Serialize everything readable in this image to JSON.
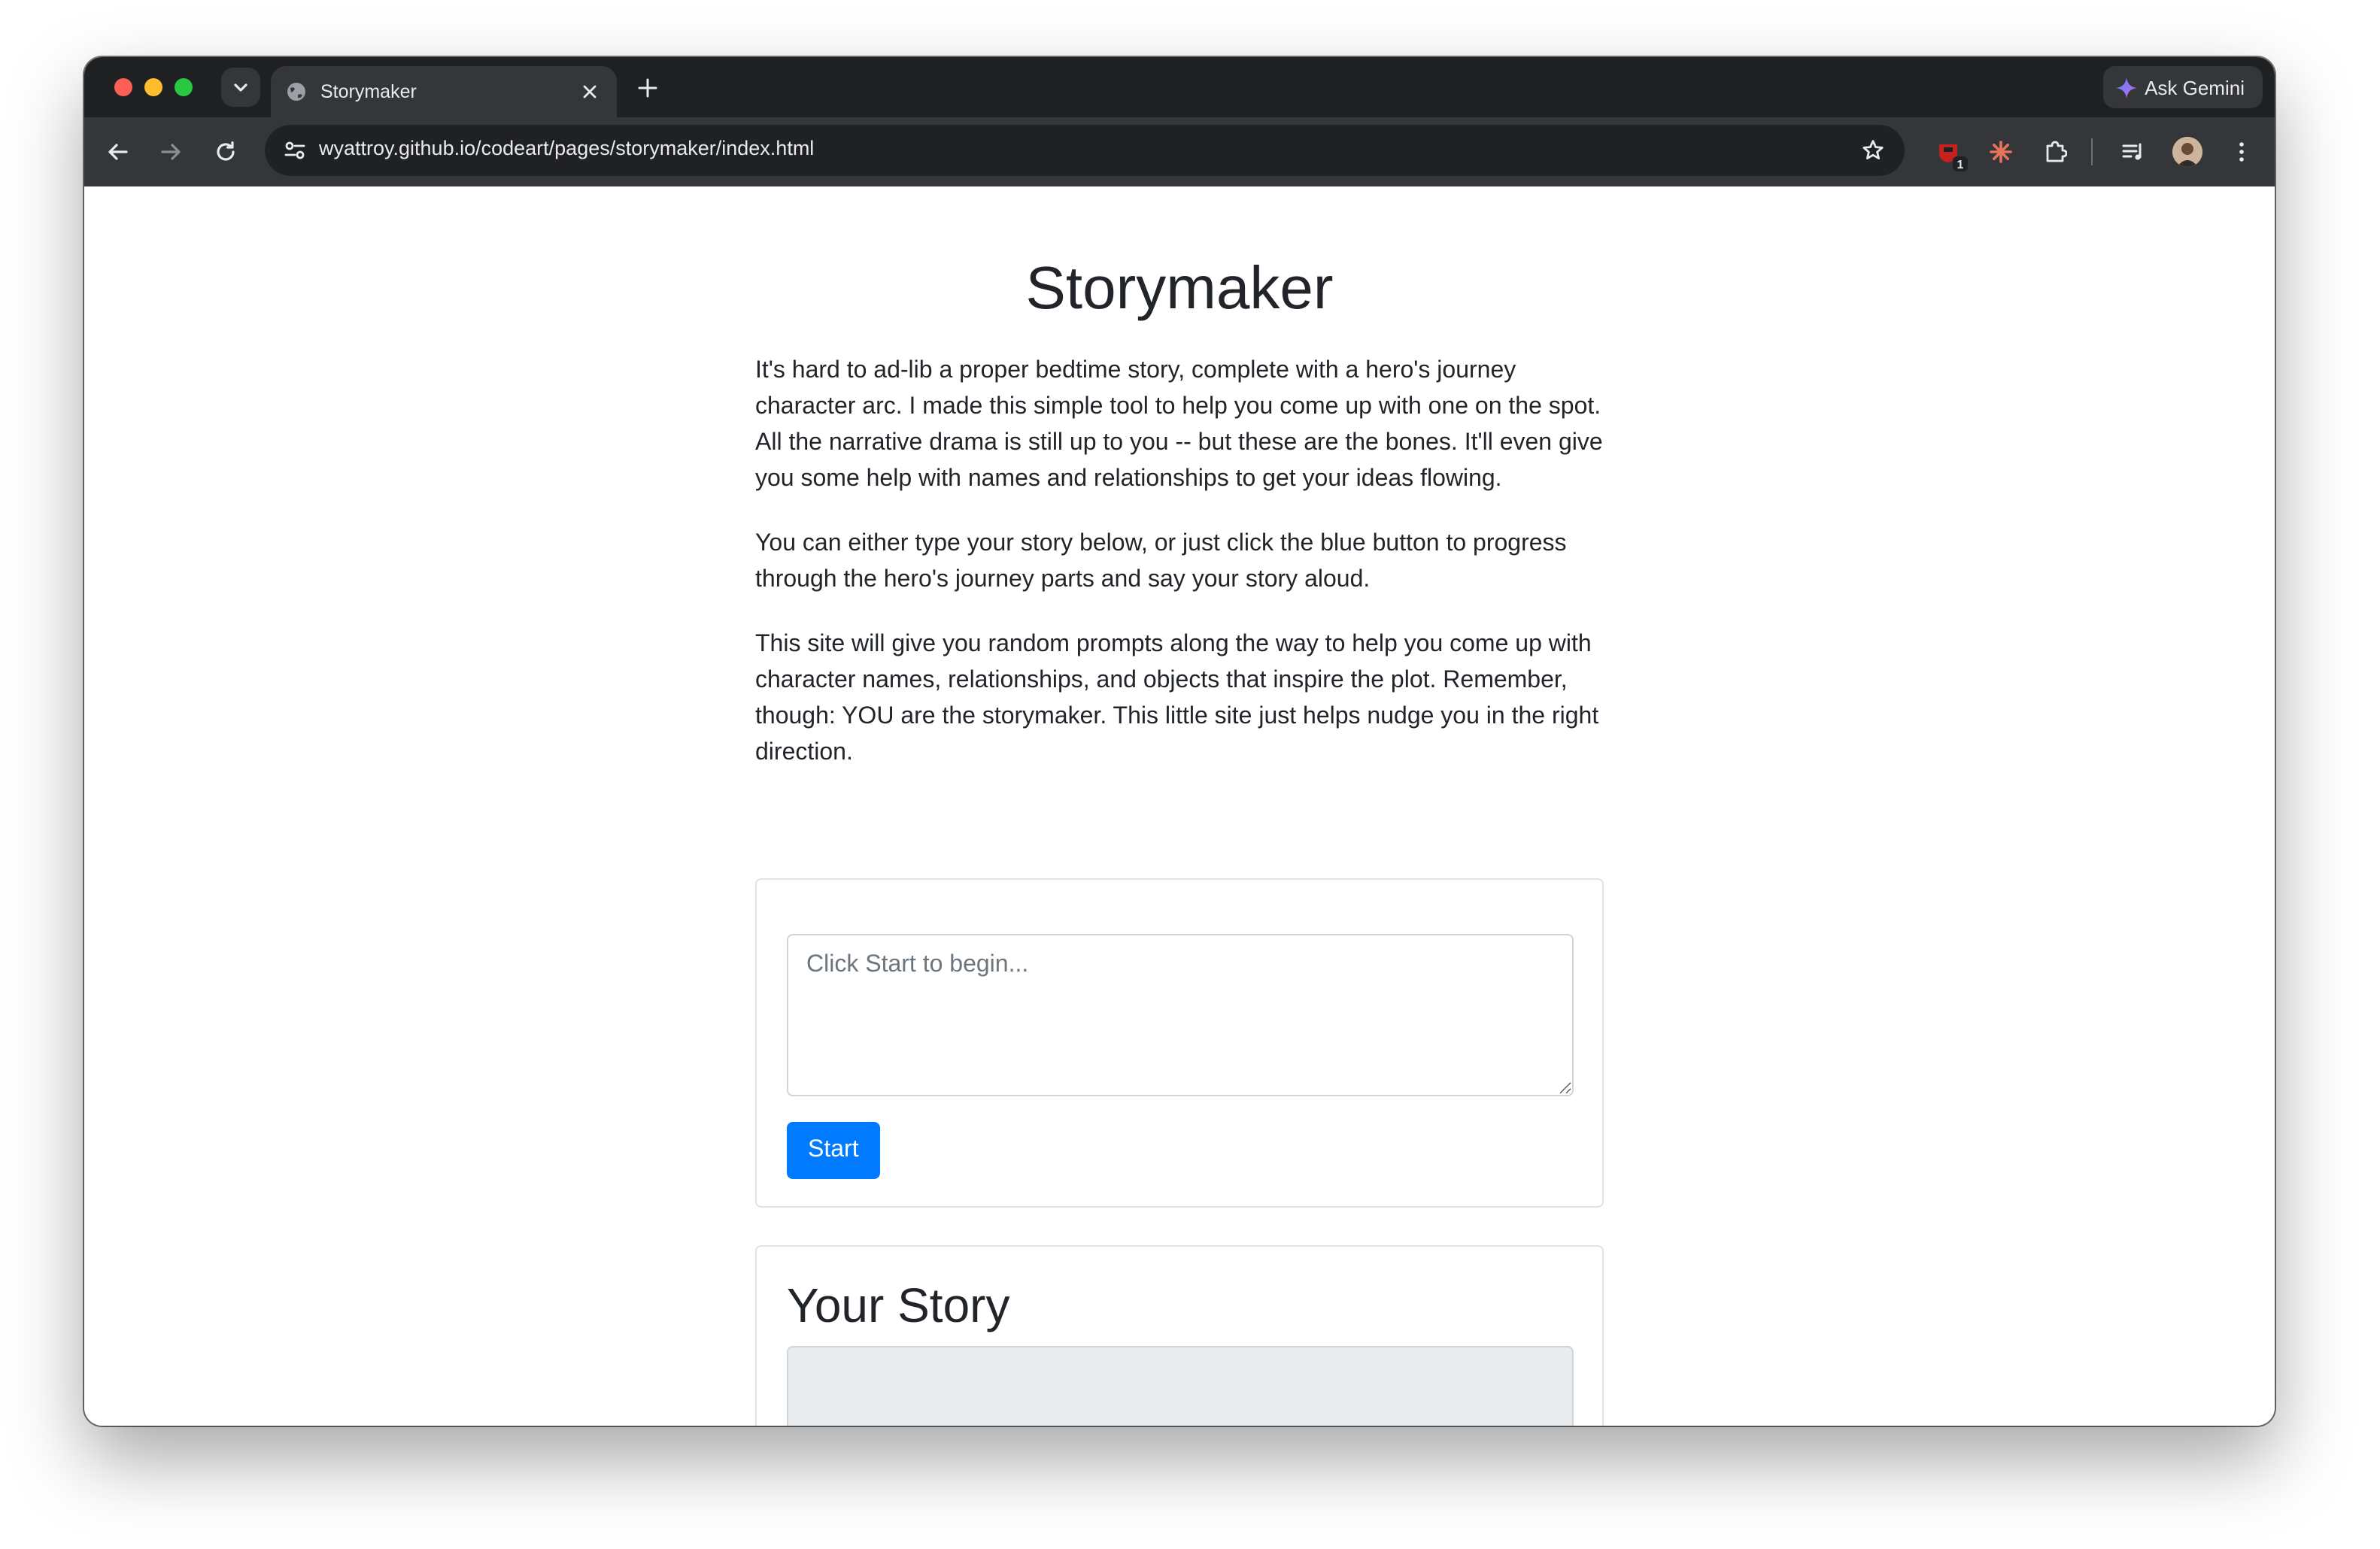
{
  "browser": {
    "tab": {
      "title": "Storymaker"
    },
    "gemini_label": "Ask Gemini",
    "url": "wyattroy.github.io/codeart/pages/storymaker/index.html",
    "extension_badge": "1",
    "colors": {
      "tabstrip": "#1f2022",
      "toolbar": "#35363a",
      "omnibox": "#202124"
    },
    "icons": [
      "tab-search-icon",
      "globe-icon",
      "close-icon",
      "plus-icon",
      "gemini-icon",
      "back-arrow-icon",
      "forward-arrow-icon",
      "reload-icon",
      "site-settings-icon",
      "star-icon",
      "extension-icon",
      "puzzle-icon",
      "reading-list-icon",
      "avatar",
      "more-icon"
    ]
  },
  "page": {
    "title": "Storymaker",
    "paragraphs": [
      "It's hard to ad-lib a proper bedtime story, complete with a hero's journey character arc. I made this simple tool to help you come up with one on the spot. All the narrative drama is still up to you -- but these are the bones. It'll even give you some help with names and relationships to get your ideas flowing.",
      "You can either type your story below, or just click the blue button to progress through the hero's journey parts and say your story aloud.",
      "This site will give you random prompts along the way to help you come up with character names, relationships, and objects that inspire the plot. Remember, though: YOU are the storymaker. This little site just helps nudge you in the right direction."
    ],
    "story_input": {
      "placeholder": "Click Start to begin...",
      "value": ""
    },
    "start_button": "Start",
    "story_heading": "Your Story",
    "colors": {
      "primary": "#007bff",
      "text": "#212529",
      "output_bg": "#e9ecef"
    }
  }
}
